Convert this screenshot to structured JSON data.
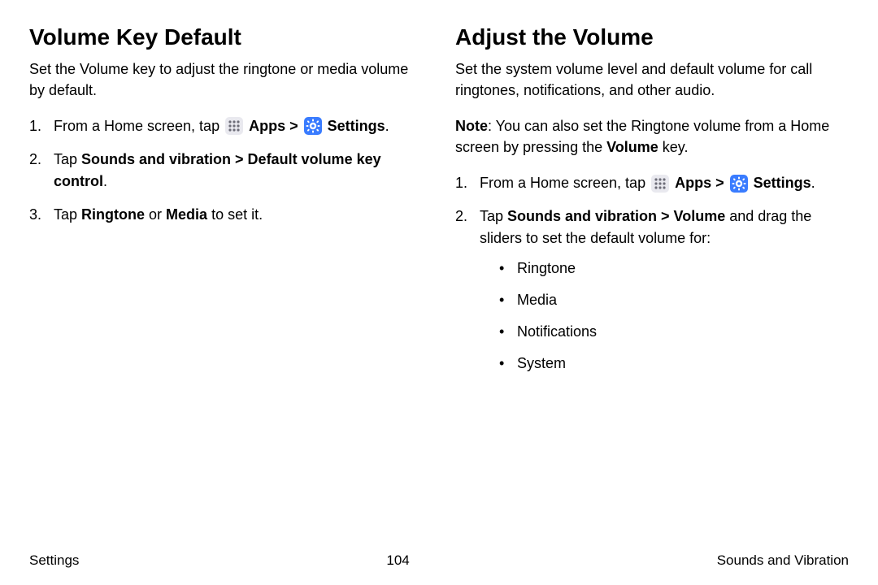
{
  "left": {
    "heading": "Volume Key Default",
    "intro": "Set the Volume key to adjust the ringtone or media volume by default.",
    "step1_pre": "From a Home screen, tap ",
    "apps_label": "Apps",
    "settings_label": "Settings",
    "sep": " > ",
    "period": ".",
    "step2_pre": "Tap ",
    "step2_bold": "Sounds and vibration > Default volume key control",
    "step3_pre": "Tap ",
    "step3_b1": "Ringtone",
    "step3_mid": " or ",
    "step3_b2": "Media",
    "step3_post": " to set it."
  },
  "right": {
    "heading": "Adjust the Volume",
    "intro": "Set the system volume level and default volume for call ringtones, notifications, and other audio.",
    "note_bold": "Note",
    "note_rest1": ": You can also set the Ringtone volume from a Home screen by pressing the ",
    "note_bold2": "Volume",
    "note_rest2": " key.",
    "step1_pre": "From a Home screen, tap ",
    "apps_label": "Apps",
    "settings_label": "Settings",
    "sep": " > ",
    "period": ".",
    "step2_pre": "Tap ",
    "step2_bold": "Sounds and vibration > Volume",
    "step2_post": " and drag the sliders to set the default volume for:",
    "bullets": {
      "b0": "Ringtone",
      "b1": "Media",
      "b2": "Notifications",
      "b3": "System"
    }
  },
  "footer": {
    "left": "Settings",
    "center": "104",
    "right": "Sounds and Vibration"
  }
}
